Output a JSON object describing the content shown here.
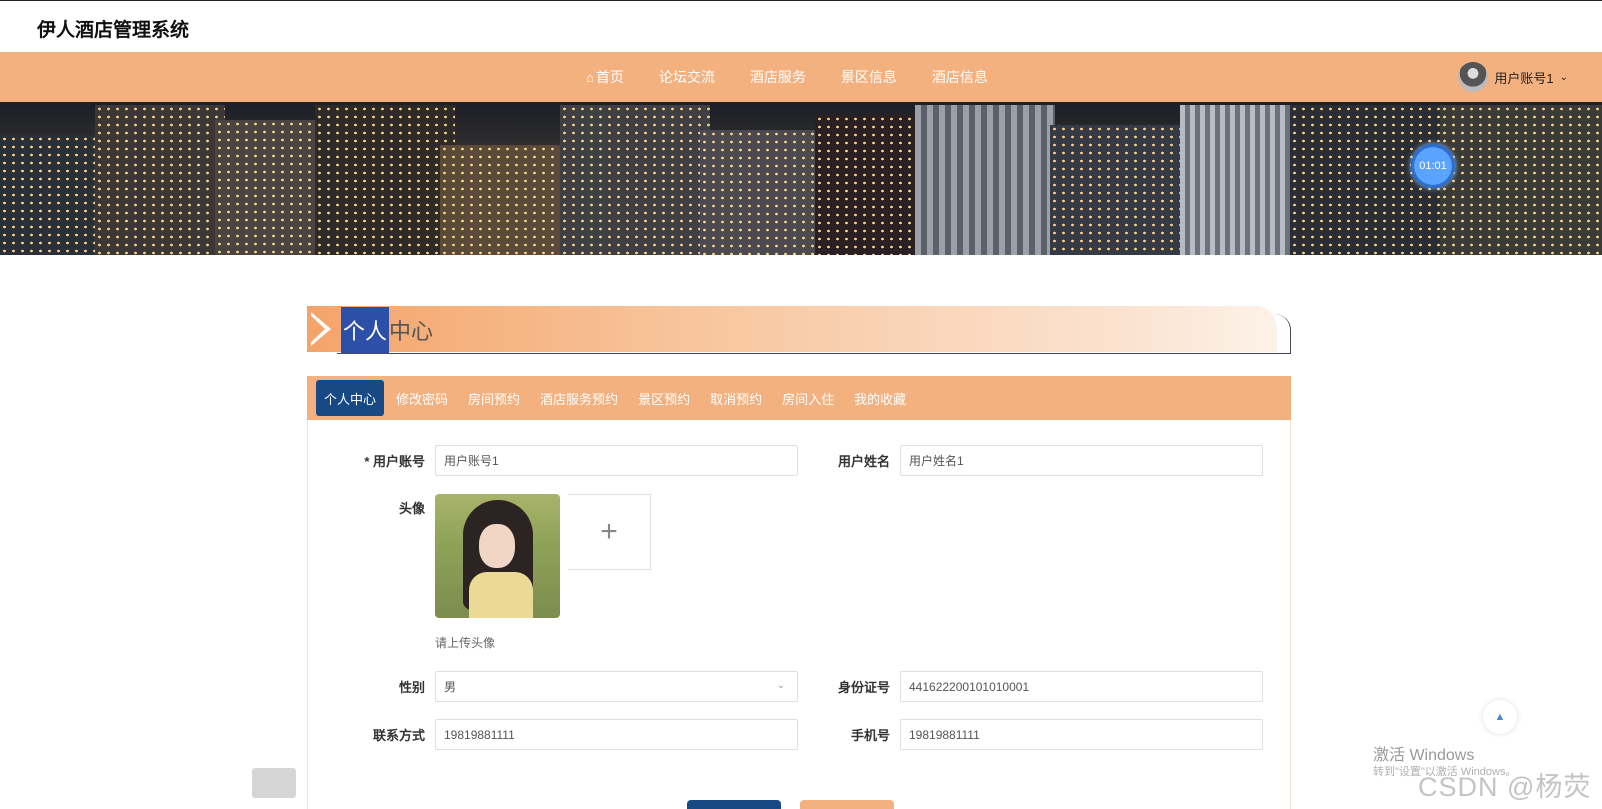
{
  "app": {
    "title": "伊人酒店管理系统"
  },
  "nav": {
    "items": [
      {
        "label": "首页",
        "icon": "home-icon"
      },
      {
        "label": "论坛交流"
      },
      {
        "label": "酒店服务"
      },
      {
        "label": "景区信息"
      },
      {
        "label": "酒店信息"
      }
    ],
    "user": {
      "label": "用户账号1"
    }
  },
  "banner": {
    "clock": "01:01"
  },
  "personal_center": {
    "title_sel": "个人",
    "title_rest": "中心"
  },
  "tabs": [
    {
      "label": "个人中心",
      "active": true
    },
    {
      "label": "修改密码"
    },
    {
      "label": "房间预约"
    },
    {
      "label": "酒店服务预约"
    },
    {
      "label": "景区预约"
    },
    {
      "label": "取消预约"
    },
    {
      "label": "房间入住"
    },
    {
      "label": "我的收藏"
    }
  ],
  "form": {
    "account_label": "* 用户账号",
    "account_value": "用户账号1",
    "name_label": "用户姓名",
    "name_value": "用户姓名1",
    "avatar_label": "头像",
    "avatar_hint": "请上传头像",
    "upload_plus": "+",
    "gender_label": "性别",
    "gender_value": "男",
    "idcard_label": "身份证号",
    "idcard_value": "441622200101010001",
    "contact_label": "联系方式",
    "contact_value": "19819881111",
    "phone_label": "手机号",
    "phone_value": "19819881111"
  },
  "overlay": {
    "windows_activate": "激活 Windows",
    "windows_sub": "转到\"设置\"以激活 Windows。",
    "watermark": "CSDN @杨荧"
  },
  "colors": {
    "nav": "#f4b180",
    "active_tab": "#174a85"
  }
}
